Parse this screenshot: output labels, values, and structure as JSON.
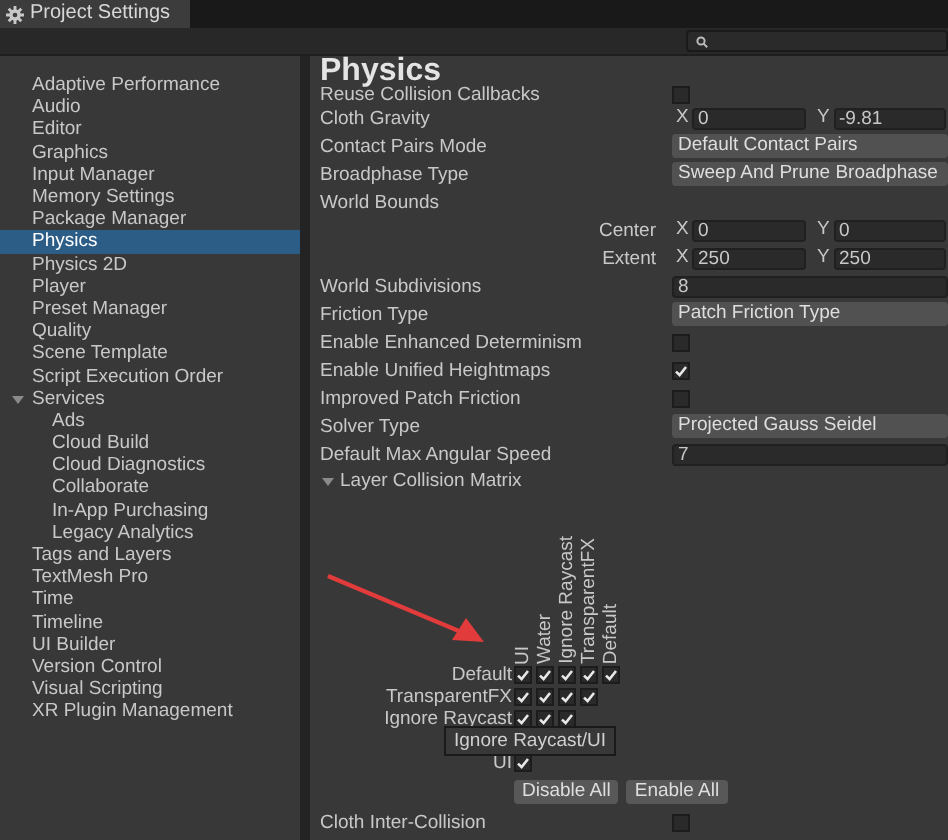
{
  "window": {
    "title": "Project Settings"
  },
  "sidebar": {
    "items": [
      {
        "label": "Adaptive Performance",
        "selected": false
      },
      {
        "label": "Audio",
        "selected": false
      },
      {
        "label": "Editor",
        "selected": false
      },
      {
        "label": "Graphics",
        "selected": false
      },
      {
        "label": "Input Manager",
        "selected": false
      },
      {
        "label": "Memory Settings",
        "selected": false
      },
      {
        "label": "Package Manager",
        "selected": false
      },
      {
        "label": "Physics",
        "selected": true
      },
      {
        "label": "Physics 2D",
        "selected": false
      },
      {
        "label": "Player",
        "selected": false
      },
      {
        "label": "Preset Manager",
        "selected": false
      },
      {
        "label": "Quality",
        "selected": false
      },
      {
        "label": "Scene Template",
        "selected": false
      },
      {
        "label": "Script Execution Order",
        "selected": false
      },
      {
        "label": "Services",
        "selected": false,
        "expanded": true,
        "children": [
          {
            "label": "Ads",
            "selected": false
          },
          {
            "label": "Cloud Build",
            "selected": false
          },
          {
            "label": "Cloud Diagnostics",
            "selected": false
          },
          {
            "label": "Collaborate",
            "selected": false
          },
          {
            "label": "In-App Purchasing",
            "selected": false
          },
          {
            "label": "Legacy Analytics",
            "selected": false
          }
        ]
      },
      {
        "label": "Tags and Layers",
        "selected": false
      },
      {
        "label": "TextMesh Pro",
        "selected": false
      },
      {
        "label": "Time",
        "selected": false
      },
      {
        "label": "Timeline",
        "selected": false
      },
      {
        "label": "UI Builder",
        "selected": false
      },
      {
        "label": "Version Control",
        "selected": false
      },
      {
        "label": "Visual Scripting",
        "selected": false
      },
      {
        "label": "XR Plugin Management",
        "selected": false
      }
    ]
  },
  "heading": "Physics",
  "properties": [
    {
      "kind": "checkbox",
      "label": "Reuse Collision Callbacks",
      "checked": false
    },
    {
      "kind": "vector",
      "label": "Cloth Gravity",
      "components": [
        {
          "axis": "X",
          "value": "0"
        },
        {
          "axis": "Y",
          "value": "-9.81"
        }
      ]
    },
    {
      "kind": "dropdown",
      "label": "Contact Pairs Mode",
      "value": "Default Contact Pairs"
    },
    {
      "kind": "dropdown",
      "label": "Broadphase Type",
      "value": "Sweep And Prune Broadphase"
    },
    {
      "kind": "group",
      "label": "World Bounds"
    },
    {
      "kind": "subvector",
      "label": "Center",
      "components": [
        {
          "axis": "X",
          "value": "0"
        },
        {
          "axis": "Y",
          "value": "0"
        }
      ]
    },
    {
      "kind": "subvector",
      "label": "Extent",
      "components": [
        {
          "axis": "X",
          "value": "250"
        },
        {
          "axis": "Y",
          "value": "250"
        }
      ]
    },
    {
      "kind": "number",
      "label": "World Subdivisions",
      "value": "8"
    },
    {
      "kind": "dropdown",
      "label": "Friction Type",
      "value": "Patch Friction Type"
    },
    {
      "kind": "checkbox",
      "label": "Enable Enhanced Determinism",
      "checked": false
    },
    {
      "kind": "checkbox",
      "label": "Enable Unified Heightmaps",
      "checked": true
    },
    {
      "kind": "checkbox",
      "label": "Improved Patch Friction",
      "checked": false
    },
    {
      "kind": "dropdown",
      "label": "Solver Type",
      "value": "Projected Gauss Seidel"
    },
    {
      "kind": "number",
      "label": "Default Max Angular Speed",
      "value": "7"
    },
    {
      "kind": "foldout",
      "label": "Layer Collision Matrix",
      "expanded": true
    }
  ],
  "matrix": {
    "columns": [
      "UI",
      "Water",
      "Ignore Raycast",
      "TransparentFX",
      "Default"
    ],
    "rows": [
      {
        "label": "Default",
        "cells": [
          true,
          true,
          true,
          true,
          true
        ]
      },
      {
        "label": "TransparentFX",
        "cells": [
          true,
          true,
          true,
          true
        ]
      },
      {
        "label": "Ignore Raycast",
        "cells": [
          true,
          true,
          true
        ]
      },
      {
        "kind": "hidden"
      },
      {
        "label": "UI",
        "cells": [
          true
        ]
      }
    ],
    "tooltip": "Ignore Raycast/UI",
    "buttons": [
      "Disable All",
      "Enable All"
    ]
  },
  "footer_property": {
    "kind": "checkbox",
    "label": "Cloth Inter-Collision",
    "checked": false
  }
}
